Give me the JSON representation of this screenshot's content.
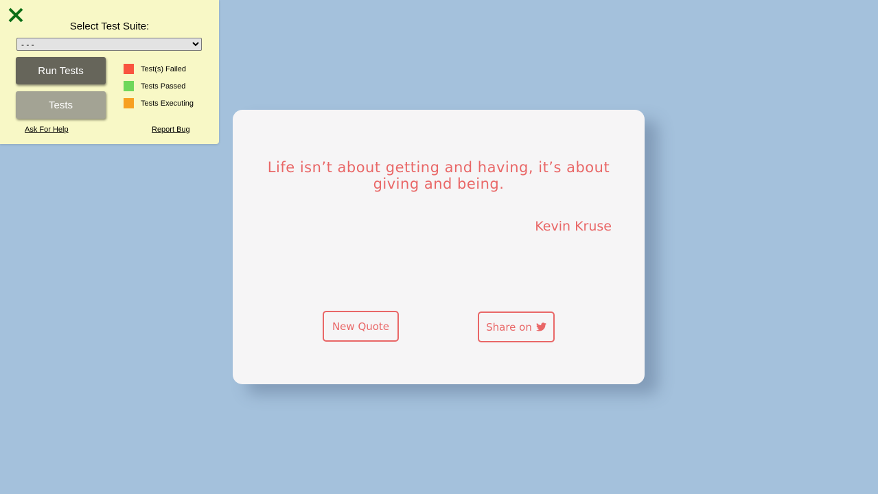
{
  "panel": {
    "close_icon": "close-x-icon",
    "suite_label": "Select Test Suite:",
    "suite_selected": "- - -",
    "run_tests_label": "Run Tests",
    "tests_label": "Tests",
    "legend": [
      {
        "label": "Test(s) Failed",
        "color": "#f9543f"
      },
      {
        "label": "Tests Passed",
        "color": "#6fd75a"
      },
      {
        "label": "Tests Executing",
        "color": "#f7a020"
      }
    ],
    "ask_help_label": "Ask For Help",
    "report_bug_label": "Report Bug"
  },
  "quote": {
    "text": "Life isn’t about getting and having, it’s about giving and being.",
    "author": "Kevin Kruse",
    "new_quote_label": "New Quote",
    "share_label": "Share on",
    "share_icon": "twitter-icon",
    "accent_color": "#e96767"
  },
  "page": {
    "background_color": "#a4c1dc"
  }
}
